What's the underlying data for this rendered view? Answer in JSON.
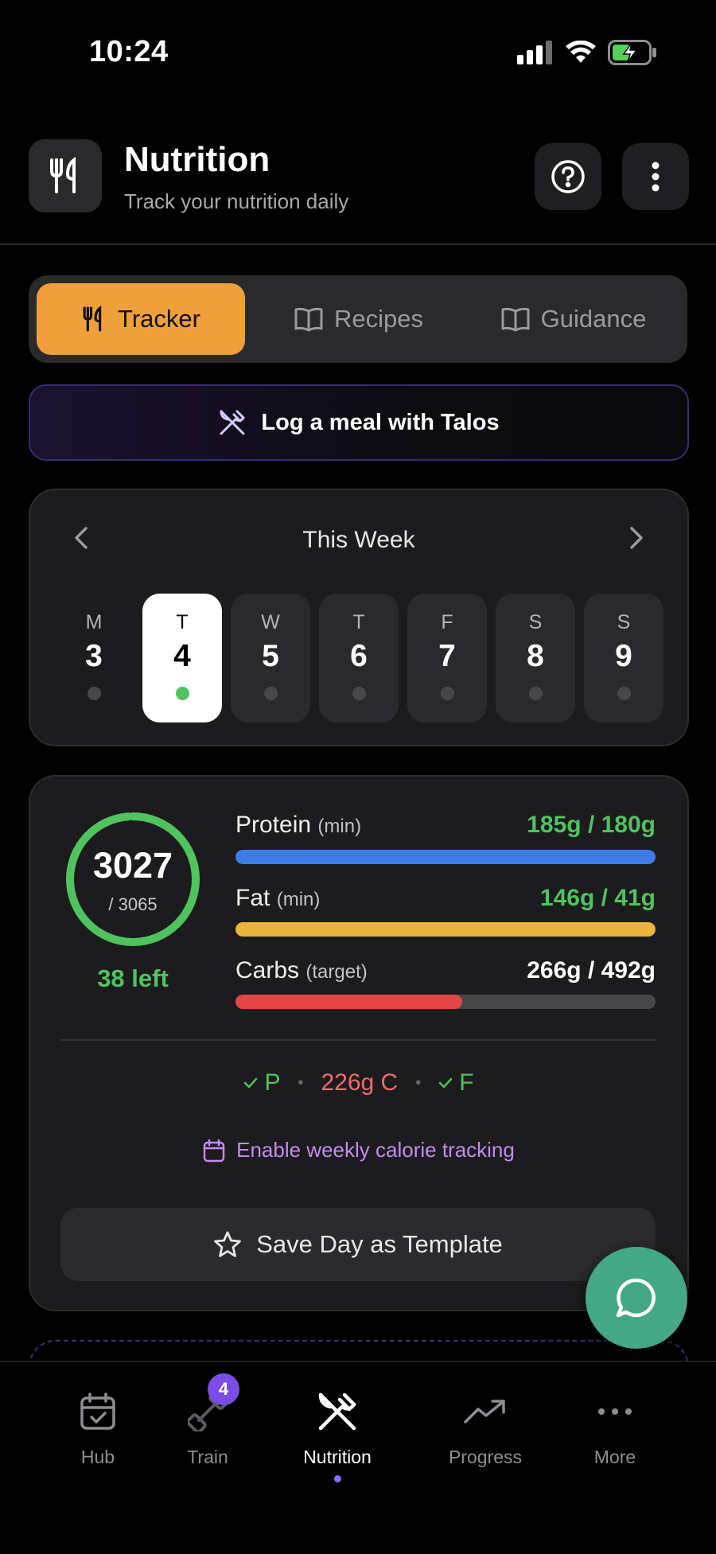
{
  "status": {
    "time": "10:24"
  },
  "header": {
    "title": "Nutrition",
    "subtitle": "Track your nutrition daily",
    "icon": "fork-knife-icon"
  },
  "tabs": [
    {
      "label": "Tracker",
      "icon": "fork-knife-icon",
      "active": true
    },
    {
      "label": "Recipes",
      "icon": "book-icon",
      "active": false
    },
    {
      "label": "Guidance",
      "icon": "book-icon",
      "active": false
    }
  ],
  "log_meal": {
    "label": "Log a meal with Talos",
    "icon": "utensils-crossed-icon"
  },
  "week": {
    "title": "This Week",
    "days": [
      {
        "letter": "M",
        "num": "3"
      },
      {
        "letter": "T",
        "num": "4",
        "active": true
      },
      {
        "letter": "W",
        "num": "5"
      },
      {
        "letter": "T",
        "num": "6"
      },
      {
        "letter": "F",
        "num": "7"
      },
      {
        "letter": "S",
        "num": "8"
      },
      {
        "letter": "S",
        "num": "9"
      }
    ]
  },
  "calories": {
    "consumed": "3027",
    "goal": "/ 3065",
    "left": "38 left",
    "progress": 0.988
  },
  "macros": [
    {
      "name": "Protein",
      "qual": "(min)",
      "value": "185g / 180g",
      "progress": 1.0,
      "color": "#3f7be8",
      "value_color": "#4fc35e"
    },
    {
      "name": "Fat",
      "qual": "(min)",
      "value": "146g / 41g",
      "progress": 1.0,
      "color": "#ecb43b",
      "value_color": "#4fc35e"
    },
    {
      "name": "Carbs",
      "qual": "(target)",
      "value": "266g / 492g",
      "progress": 0.54,
      "color": "#e54545",
      "value_color": "#ffffff"
    }
  ],
  "summary": {
    "p": "P",
    "c": "226g C",
    "f": "F"
  },
  "weekly_tracking": {
    "label": "Enable weekly calorie tracking"
  },
  "save_template": {
    "label": "Save Day as Template"
  },
  "nav": [
    {
      "label": "Hub",
      "icon": "calendar-check-icon"
    },
    {
      "label": "Train",
      "icon": "dumbbell-icon",
      "badge": "4"
    },
    {
      "label": "Nutrition",
      "icon": "utensils-crossed-icon",
      "active": true
    },
    {
      "label": "Progress",
      "icon": "trending-up-icon"
    },
    {
      "label": "More",
      "icon": "more-horizontal-icon"
    }
  ],
  "colors": {
    "accent": "#f0a03a",
    "green": "#4fc35e",
    "purple": "#c58af0"
  }
}
